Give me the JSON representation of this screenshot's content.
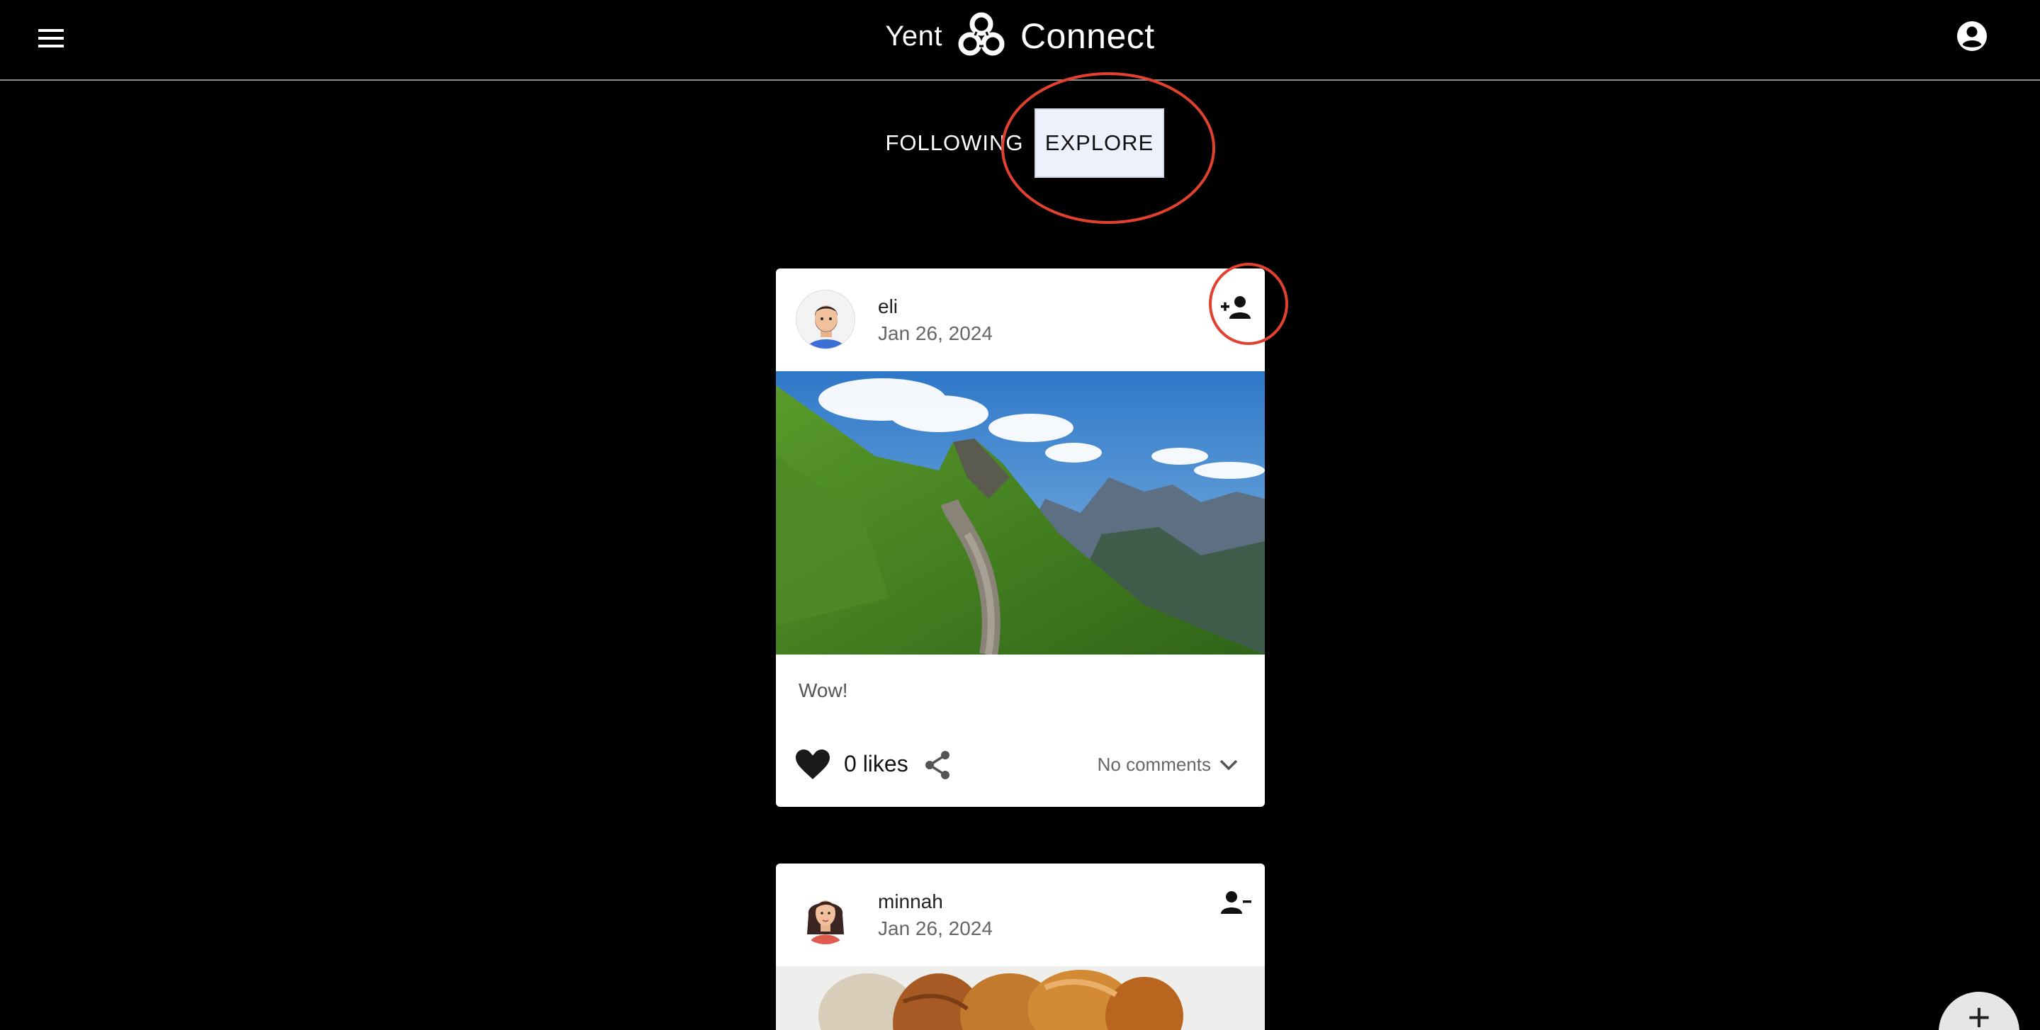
{
  "app": {
    "brand_left": "Yent",
    "brand_right": "Connect"
  },
  "tabs": [
    {
      "label": "FOLLOWING",
      "active": false
    },
    {
      "label": "EXPLORE",
      "active": true
    }
  ],
  "posts": [
    {
      "user": "eli",
      "date": "Jan 26, 2024",
      "caption": "Wow!",
      "likes_label": "0 likes",
      "comments_label": "No comments",
      "follow_icon": "person-add-icon"
    },
    {
      "user": "minnah",
      "date": "Jan 26, 2024",
      "follow_icon": "person-remove-icon"
    }
  ],
  "fab": {
    "label": "+"
  },
  "colors": {
    "background": "#000000",
    "card": "#ffffff",
    "tab_active_bg": "#edf1fb",
    "annotation": "#e2412f"
  }
}
